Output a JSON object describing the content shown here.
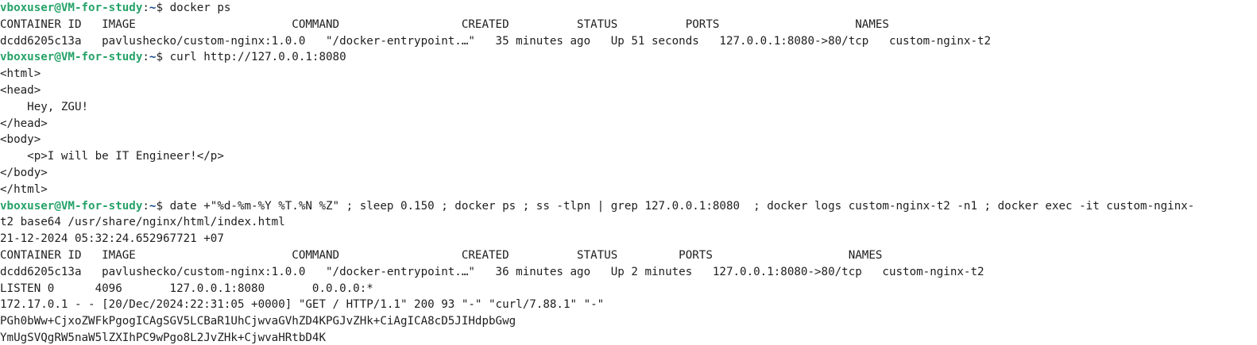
{
  "colors": {
    "background": "#ffffff",
    "text": "#1e1e1e",
    "prompt_user": "#26a269",
    "prompt_path": "#12488b"
  },
  "lines": [
    {
      "type": "prompt",
      "user": "vboxuser@VM-for-study",
      "sep": ":",
      "path": "~",
      "sym": "$ ",
      "cmd": "docker ps"
    },
    {
      "type": "output",
      "text": "CONTAINER ID   IMAGE                       COMMAND                  CREATED          STATUS          PORTS                    NAMES"
    },
    {
      "type": "output",
      "text": "dcdd6205c13a   pavlushecko/custom-nginx:1.0.0   \"/docker-entrypoint.…\"   35 minutes ago   Up 51 seconds   127.0.0.1:8080->80/tcp   custom-nginx-t2"
    },
    {
      "type": "prompt",
      "user": "vboxuser@VM-for-study",
      "sep": ":",
      "path": "~",
      "sym": "$ ",
      "cmd": "curl http://127.0.0.1:8080"
    },
    {
      "type": "output",
      "text": "<html>"
    },
    {
      "type": "output",
      "text": "<head>"
    },
    {
      "type": "output",
      "text": "    Hey, ZGU!"
    },
    {
      "type": "output",
      "text": "</head>"
    },
    {
      "type": "output",
      "text": "<body>"
    },
    {
      "type": "output",
      "text": "    <p>I will be IT Engineer!</p>"
    },
    {
      "type": "output",
      "text": "</body>"
    },
    {
      "type": "output",
      "text": "</html>"
    },
    {
      "type": "prompt",
      "user": "vboxuser@VM-for-study",
      "sep": ":",
      "path": "~",
      "sym": "$ ",
      "cmd": "date +\"%d-%m-%Y %T.%N %Z\" ; sleep 0.150 ; docker ps ; ss -tlpn | grep 127.0.0.1:8080  ; docker logs custom-nginx-t2 -n1 ; docker exec -it custom-nginx-"
    },
    {
      "type": "output",
      "text": "t2 base64 /usr/share/nginx/html/index.html"
    },
    {
      "type": "output",
      "text": "21-12-2024 05:32:24.652967721 +07"
    },
    {
      "type": "output",
      "text": "CONTAINER ID   IMAGE                       COMMAND                  CREATED          STATUS         PORTS                    NAMES"
    },
    {
      "type": "output",
      "text": "dcdd6205c13a   pavlushecko/custom-nginx:1.0.0   \"/docker-entrypoint.…\"   36 minutes ago   Up 2 minutes   127.0.0.1:8080->80/tcp   custom-nginx-t2"
    },
    {
      "type": "output",
      "text": "LISTEN 0      4096       127.0.0.1:8080       0.0.0.0:*"
    },
    {
      "type": "output",
      "text": "172.17.0.1 - - [20/Dec/2024:22:31:05 +0000] \"GET / HTTP/1.1\" 200 93 \"-\" \"curl/7.88.1\" \"-\""
    },
    {
      "type": "output",
      "text": "PGh0bWw+CjxoZWFkPgogICAgSGV5LCBaR1UhCjwvaGVhZD4KPGJvZHk+CiAgICA8cD5JIHdpbGwg"
    },
    {
      "type": "output",
      "text": "YmUgSVQgRW5naW5lZXIhPC9wPgo8L2JvZHk+CjwvaHRtbD4K"
    }
  ]
}
